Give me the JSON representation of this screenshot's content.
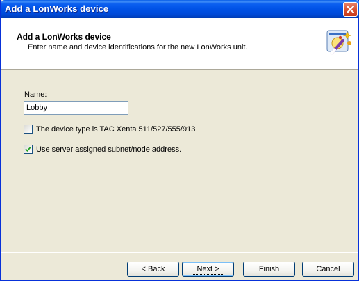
{
  "window": {
    "title": "Add a LonWorks device"
  },
  "header": {
    "title": "Add a LonWorks device",
    "subtitle": "Enter name and device identifications for the new LonWorks unit.",
    "icon": "wizard-wand-icon"
  },
  "form": {
    "name_label": "Name:",
    "name_value": "Lobby",
    "checkboxes": [
      {
        "label": "The device type is TAC Xenta 511/527/555/913",
        "checked": false
      },
      {
        "label": "Use server assigned subnet/node address.",
        "checked": true
      }
    ]
  },
  "buttons": {
    "back": "< Back",
    "next": "Next >",
    "finish": "Finish",
    "cancel": "Cancel"
  },
  "colors": {
    "titlebar": "#0052e6",
    "close": "#d8502f",
    "dialog_bg": "#ece9d8"
  }
}
